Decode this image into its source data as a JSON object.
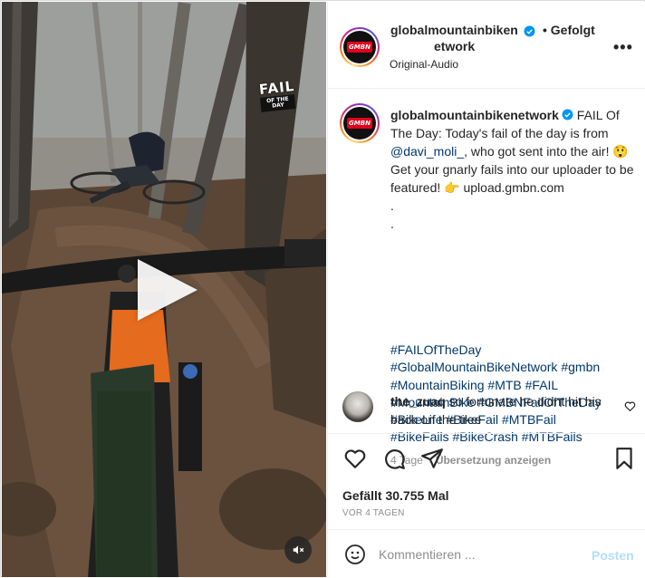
{
  "post": {
    "author": "globalmountainbikenetwork",
    "author_line1": "globalmountainbiken",
    "author_line2": "etwork",
    "follow_status": "• Gefolgt",
    "audio": "Original-Audio",
    "more_glyph": "•••"
  },
  "video": {
    "badge_line1": "FAIL",
    "badge_line2": "OF THE DAY",
    "avatar_logo_text": "GMBN"
  },
  "caption": {
    "author": "globalmountainbikenetwork",
    "text_before_mention": " FAIL Of The Day: Today's fail of the day is from ",
    "mention": "@davi_moli_",
    "text_after_mention": ", who got sent into the air! 😲 Get your gnarly fails into our uploader to be featured! 👉 upload.gmbn.com\n.\n.",
    "hashtags": [
      "#FAILOfTheDay",
      "#GlobalMountainBikeNetwork",
      "#gmbn",
      "#MountainBiking",
      "#MTB",
      "#FAIL",
      "#MountainBike",
      "#GMBNFailOfTheDay",
      "#BikeLife",
      "#BikeFail",
      "#MTBFail",
      "#BikeFails",
      "#BikeCrash",
      "#MTBFails"
    ],
    "age": "4 Tage",
    "translate": "Übersetzung anzeigen"
  },
  "comments": [
    {
      "user": "the_zuaq",
      "text": " so fortunate he didnt hit his back on the tree"
    }
  ],
  "stats": {
    "likes": "Gefällt 30.755 Mal",
    "posted": "VOR 4 TAGEN"
  },
  "comment_box": {
    "placeholder": "Kommentieren ...",
    "post_label": "Posten"
  },
  "colors": {
    "link": "#00376b",
    "verified": "#0095f6",
    "post_disabled": "#b2dffc",
    "muted": "#8e8e8e"
  },
  "icons": {
    "like": "heart-icon",
    "comment": "comment-icon",
    "share": "send-icon",
    "save": "bookmark-icon",
    "emoji": "smiley-icon",
    "mute": "speaker-muted-icon",
    "play": "play-icon"
  }
}
